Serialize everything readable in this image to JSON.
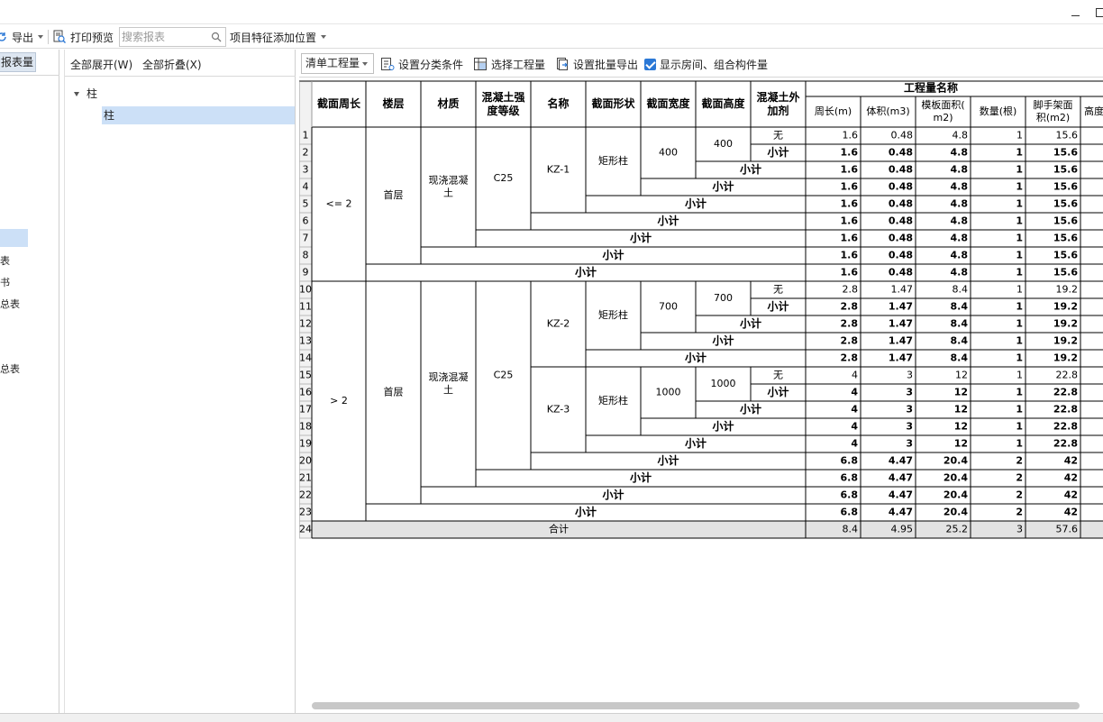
{
  "toolbar": {
    "export_label": "导出",
    "print_preview_label": "打印预览",
    "search_placeholder": "搜索报表",
    "project_feature_label": "项目特征添加位置"
  },
  "left_panel": {
    "tab_label": "报表量",
    "items": [
      "表",
      "书",
      "总表",
      "总表"
    ]
  },
  "tree": {
    "expand_all": "全部展开(W)",
    "collapse_all": "全部折叠(X)",
    "root": "柱",
    "child": "柱"
  },
  "main_toolbar": {
    "mode_select": "清单工程量",
    "set_category": "设置分类条件",
    "select_quantity": "选择工程量",
    "batch_export": "设置批量导出",
    "show_rooms": "显示房间、组合构件量"
  },
  "table": {
    "headers": {
      "perimeter_section": "截面周长",
      "floor": "楼层",
      "material": "材质",
      "concrete_grade": "混凝土强度等级",
      "name": "名称",
      "section_shape": "截面形状",
      "section_width": "截面宽度",
      "section_height": "截面高度",
      "additive": "混凝土外加剂",
      "quantity_group": "工程量名称",
      "q_perimeter": "周长(m)",
      "q_volume": "体积(m3)",
      "q_formwork": "模板面积(m2)",
      "q_count": "数量(根)",
      "q_scaffold": "脚手架面积(m2)",
      "q_height": "高度"
    },
    "subtotal_label": "小计",
    "total_label": "合计",
    "groups": {
      "perimeter": [
        "<= 2",
        "> 2"
      ],
      "floor": "首层",
      "material": "现浇混凝土",
      "grade": "C25",
      "shape": "矩形柱",
      "names": [
        "KZ-1",
        "KZ-2",
        "KZ-3"
      ],
      "widths": [
        "400",
        "700",
        "1000"
      ],
      "heights": [
        "400",
        "700",
        "1000"
      ],
      "additive": "无"
    },
    "rows": [
      [
        "1.6",
        "0.48",
        "4.8",
        "1",
        "15.6"
      ],
      [
        "1.6",
        "0.48",
        "4.8",
        "1",
        "15.6"
      ],
      [
        "1.6",
        "0.48",
        "4.8",
        "1",
        "15.6"
      ],
      [
        "1.6",
        "0.48",
        "4.8",
        "1",
        "15.6"
      ],
      [
        "1.6",
        "0.48",
        "4.8",
        "1",
        "15.6"
      ],
      [
        "1.6",
        "0.48",
        "4.8",
        "1",
        "15.6"
      ],
      [
        "1.6",
        "0.48",
        "4.8",
        "1",
        "15.6"
      ],
      [
        "1.6",
        "0.48",
        "4.8",
        "1",
        "15.6"
      ],
      [
        "1.6",
        "0.48",
        "4.8",
        "1",
        "15.6"
      ],
      [
        "2.8",
        "1.47",
        "8.4",
        "1",
        "19.2"
      ],
      [
        "2.8",
        "1.47",
        "8.4",
        "1",
        "19.2"
      ],
      [
        "2.8",
        "1.47",
        "8.4",
        "1",
        "19.2"
      ],
      [
        "2.8",
        "1.47",
        "8.4",
        "1",
        "19.2"
      ],
      [
        "2.8",
        "1.47",
        "8.4",
        "1",
        "19.2"
      ],
      [
        "4",
        "3",
        "12",
        "1",
        "22.8"
      ],
      [
        "4",
        "3",
        "12",
        "1",
        "22.8"
      ],
      [
        "4",
        "3",
        "12",
        "1",
        "22.8"
      ],
      [
        "4",
        "3",
        "12",
        "1",
        "22.8"
      ],
      [
        "4",
        "3",
        "12",
        "1",
        "22.8"
      ],
      [
        "6.8",
        "4.47",
        "20.4",
        "2",
        "42"
      ],
      [
        "6.8",
        "4.47",
        "20.4",
        "2",
        "42"
      ],
      [
        "6.8",
        "4.47",
        "20.4",
        "2",
        "42"
      ],
      [
        "6.8",
        "4.47",
        "20.4",
        "2",
        "42"
      ],
      [
        "8.4",
        "4.95",
        "25.2",
        "3",
        "57.6"
      ]
    ]
  }
}
